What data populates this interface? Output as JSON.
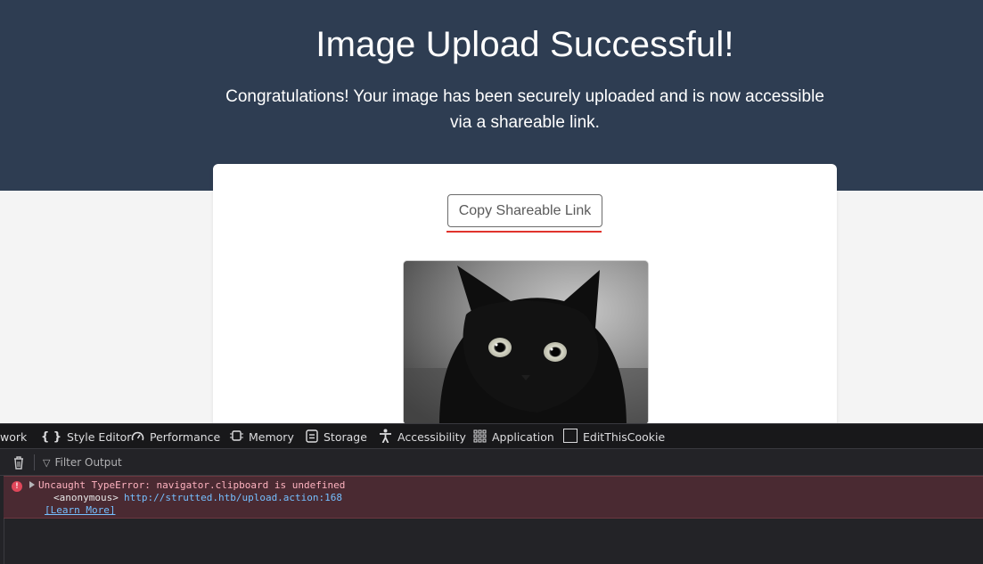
{
  "hero": {
    "title": "Image Upload Successful!",
    "subtitle": "Congratulations! Your image has been securely uploaded and is now accessible via a shareable link."
  },
  "card": {
    "copy_button_label": "Copy Shareable Link"
  },
  "devtools": {
    "tabs": [
      {
        "label": "work",
        "icon": "none"
      },
      {
        "label": "Style Editor",
        "icon": "braces-icon"
      },
      {
        "label": "Performance",
        "icon": "gauge-icon"
      },
      {
        "label": "Memory",
        "icon": "chip-icon"
      },
      {
        "label": "Storage",
        "icon": "storage-icon"
      },
      {
        "label": "Accessibility",
        "icon": "accessibility-icon"
      },
      {
        "label": "Application",
        "icon": "grid-icon"
      },
      {
        "label": "EditThisCookie",
        "icon": "square-icon"
      }
    ],
    "filter_placeholder": "Filter Output",
    "console": {
      "error_message": "Uncaught TypeError: navigator.clipboard is undefined",
      "stack_function": "<anonymous>",
      "stack_location": "http://strutted.htb/upload.action:168",
      "learn_more": "[Learn More]"
    }
  },
  "colors": {
    "hero_bg": "#2e3d52",
    "accent_underline": "#e0332c",
    "devtools_bg": "#232327",
    "error_row_bg": "#4a2a32",
    "link": "#75bfff"
  }
}
